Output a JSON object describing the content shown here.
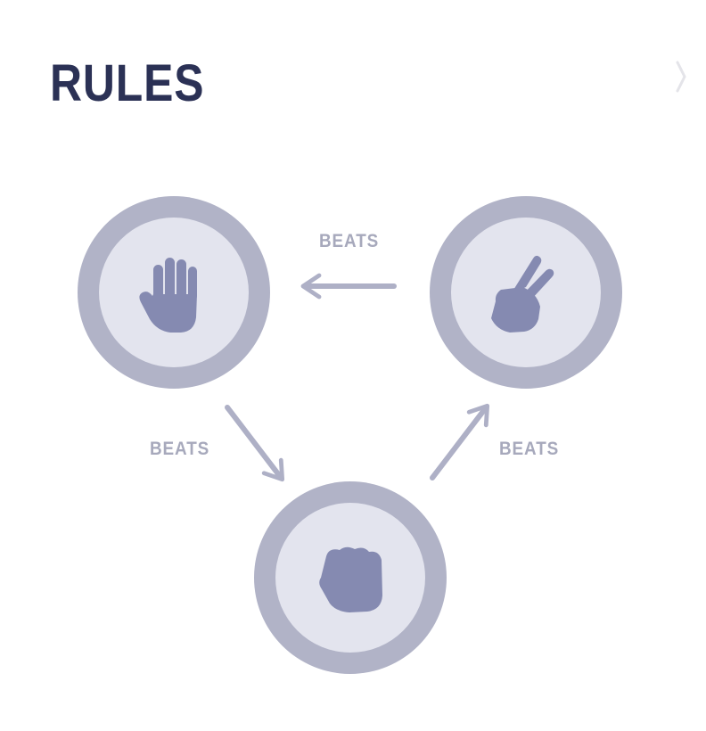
{
  "modal": {
    "title": "RULES",
    "close_icon": "close-icon"
  },
  "diagram": {
    "beats_label": "BEATS",
    "choices": [
      {
        "id": "paper",
        "icon": "hand-open-icon"
      },
      {
        "id": "scissors",
        "icon": "hand-scissors-icon"
      },
      {
        "id": "rock",
        "icon": "hand-fist-icon"
      }
    ],
    "relations": [
      {
        "from": "scissors",
        "to": "paper",
        "label": "BEATS"
      },
      {
        "from": "paper",
        "to": "rock",
        "label": "BEATS"
      },
      {
        "from": "rock",
        "to": "scissors",
        "label": "BEATS"
      }
    ]
  },
  "colors": {
    "title": "#2b3155",
    "outer_ring": "#b1b3c7",
    "inner_circle": "#e3e4ee",
    "hand": "#858ab1",
    "arrow": "#aeb0c6",
    "label": "#a7a9bc",
    "close": "#e4e4e9"
  }
}
